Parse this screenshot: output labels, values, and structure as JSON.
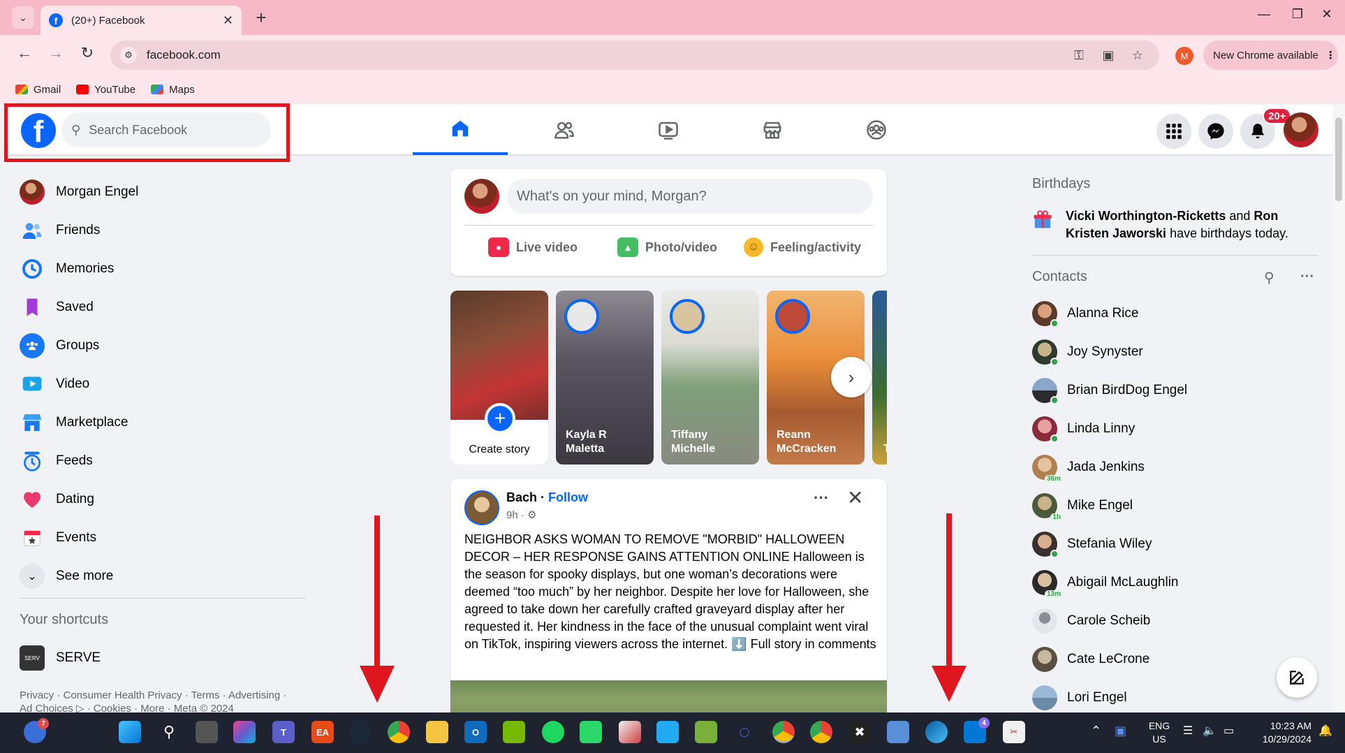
{
  "browser": {
    "tab_title": "(20+) Facebook",
    "tab_close": "✕",
    "new_tab": "+",
    "url": "facebook.com",
    "profile_initial": "M",
    "update_label": "New Chrome available",
    "bookmarks": [
      {
        "label": "Gmail"
      },
      {
        "label": "YouTube"
      },
      {
        "label": "Maps"
      }
    ]
  },
  "header": {
    "search_placeholder": "Search Facebook",
    "notification_badge": "20+",
    "nav_tabs": [
      "home",
      "friends",
      "video",
      "marketplace",
      "groups"
    ]
  },
  "left_nav": {
    "items": [
      {
        "label": "Morgan Engel",
        "icon": "profile-avatar"
      },
      {
        "label": "Friends",
        "icon": "friends-icon"
      },
      {
        "label": "Memories",
        "icon": "memories-icon"
      },
      {
        "label": "Saved",
        "icon": "saved-icon"
      },
      {
        "label": "Groups",
        "icon": "groups-icon"
      },
      {
        "label": "Video",
        "icon": "video-icon"
      },
      {
        "label": "Marketplace",
        "icon": "marketplace-icon"
      },
      {
        "label": "Feeds",
        "icon": "feeds-icon"
      },
      {
        "label": "Dating",
        "icon": "dating-icon"
      },
      {
        "label": "Events",
        "icon": "events-icon"
      },
      {
        "label": "See more",
        "icon": "chevron-down-icon"
      }
    ],
    "shortcuts_title": "Your shortcuts",
    "shortcut": {
      "label": "SERVE",
      "icon_text": "SERV"
    },
    "footer_line1": "Privacy · Consumer Health Privacy · Terms · Advertising ·",
    "footer_line2": "Ad Choices ▷ · Cookies · More · Meta © 2024"
  },
  "composer": {
    "placeholder": "What's on your mind, Morgan?",
    "actions": [
      {
        "label": "Live video"
      },
      {
        "label": "Photo/video"
      },
      {
        "label": "Feeling/activity"
      }
    ]
  },
  "stories": {
    "create_label": "Create story",
    "items": [
      {
        "name_line1": "Kayla R",
        "name_line2": "Maletta"
      },
      {
        "name_line1": "Tiffany",
        "name_line2": "Michelle"
      },
      {
        "name_line1": "Reann",
        "name_line2": "McCracken"
      },
      {
        "name_line1": "T",
        "name_line2": ""
      }
    ]
  },
  "post": {
    "author": "Bach",
    "separator": " · ",
    "follow_label": "Follow",
    "time": "9h ·",
    "text": "NEIGHBOR ASKS WOMAN TO REMOVE \"MORBID\" HALLOWEEN DECOR – HER RESPONSE GAINS ATTENTION ONLINE Halloween is the season for spooky displays, but one woman’s decorations were deemed “too much” by her neighbor. Despite her love for Halloween, she agreed to take down her carefully crafted graveyard display after her requested it. Her kindness in the face of the unusual complaint went viral on TikTok, inspiring viewers across the internet. ⬇️ Full story in comments"
  },
  "right_sidebar": {
    "birthdays_title": "Birthdays",
    "birthday_name1": "Vicki Worthington-Ricketts",
    "birthday_and": " and ",
    "birthday_name2": "Ron Kristen Jaworski",
    "birthday_suffix": " have birthdays today.",
    "contacts_title": "Contacts",
    "contacts": [
      {
        "name": "Alanna Rice",
        "status": "online"
      },
      {
        "name": "Joy Synyster",
        "status": "online"
      },
      {
        "name": "Brian BirdDog Engel",
        "status": "online"
      },
      {
        "name": "Linda Linny",
        "status": "online"
      },
      {
        "name": "Jada Jenkins",
        "status": "36m"
      },
      {
        "name": "Mike Engel",
        "status": "1h"
      },
      {
        "name": "Stefania Wiley",
        "status": "online"
      },
      {
        "name": "Abigail McLaughlin",
        "status": "13m"
      },
      {
        "name": "Carole Scheib",
        "status": ""
      },
      {
        "name": "Cate LeCrone",
        "status": ""
      },
      {
        "name": "Lori Engel",
        "status": ""
      }
    ]
  },
  "taskbar": {
    "weather_badge": "7",
    "teams_badge": "4",
    "lang_line1": "ENG",
    "lang_line2": "US",
    "time": "10:23 AM",
    "date": "10/29/2024"
  },
  "colors": {
    "fb_blue": "#0866ff",
    "chrome_pink": "#f7b9c7",
    "highlight_red": "#e0161e"
  }
}
